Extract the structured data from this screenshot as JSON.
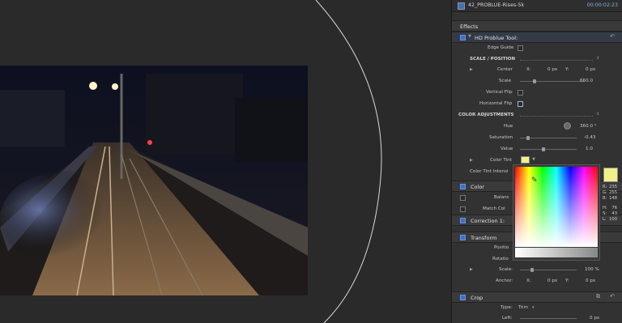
{
  "header": {
    "clip_name": "42_PROBLUE-Rises-5k",
    "timecode": "00:00:02:23"
  },
  "effects": {
    "title": "Effects",
    "plugin": {
      "name": "HD Problue Tool:",
      "edge_guide": "Edge Guide",
      "scale_position": "SCALE / POSITION",
      "center": {
        "label": "Center",
        "x_label": "X:",
        "x": "0 px",
        "y_label": "Y:",
        "y": "0 px"
      },
      "scale": {
        "label": "Scale",
        "value": "660.0"
      },
      "vertical_flip": "Vertical Flip",
      "horizontal_flip": "Horizontal Flip",
      "color_adjustments": "COLOR ADJUSTMENTS",
      "hue": {
        "label": "Hue",
        "value": "360.0 °"
      },
      "saturation": {
        "label": "Saturation",
        "value": "-0.43"
      },
      "value": {
        "label": "Value",
        "value": "1.0"
      },
      "color_tint": {
        "label": "Color Tint",
        "swatch": "#f1f18a"
      },
      "color_tint_intensity": "Color Tint Intensi"
    }
  },
  "color": {
    "title": "Color",
    "balance": "Balanc",
    "match": "Match Col"
  },
  "correction": {
    "title": "Correction 1:"
  },
  "transform": {
    "title": "Transform",
    "position": "Positio",
    "rotation": "Rotatio",
    "scale": {
      "label": "Scale:",
      "value": "100 %"
    },
    "anchor": {
      "label": "Anchor:",
      "x_label": "X:",
      "x": "0 px",
      "y_label": "Y:",
      "y": "0 px"
    }
  },
  "crop": {
    "title": "Crop",
    "type_label": "Type:",
    "type_value": "Trim",
    "left_label": "Left:",
    "left_value": "0 px"
  },
  "picker": {
    "r_label": "R:",
    "r": "235",
    "g_label": "G:",
    "g": "255",
    "b_label": "B:",
    "b": "148",
    "h_label": "H:",
    "h": "76",
    "s_label": "S:",
    "s": "43",
    "l_label": "L:",
    "l": "100"
  },
  "colors": {
    "accent": "#3c6fd0",
    "timecode": "#7fb0e8",
    "panel": "#323232",
    "tint": "#f1f18a"
  }
}
